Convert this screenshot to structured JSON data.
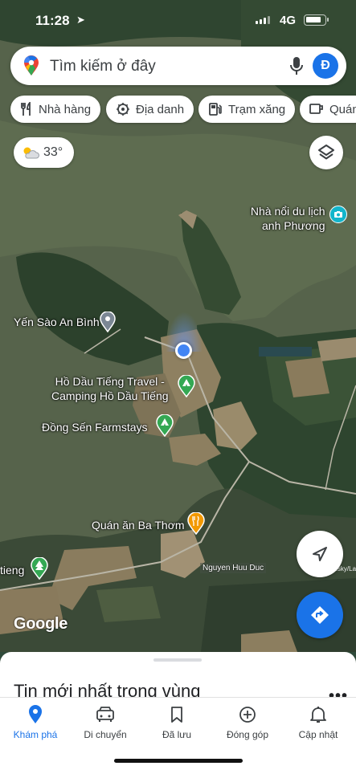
{
  "status_bar": {
    "time": "11:28",
    "network": "4G"
  },
  "search": {
    "placeholder": "Tìm kiếm ở đây",
    "avatar_letter": "Đ"
  },
  "chips": [
    {
      "label": "Nhà hàng",
      "icon": "fork-knife-icon"
    },
    {
      "label": "Địa danh",
      "icon": "landmark-icon"
    },
    {
      "label": "Trạm xăng",
      "icon": "gas-station-icon"
    },
    {
      "label": "Quán",
      "icon": "coffee-cup-icon"
    }
  ],
  "weather": {
    "temperature": "33°",
    "icon": "partly-sunny-icon"
  },
  "map": {
    "places": [
      {
        "name_line1": "Nhà nổi du lịch",
        "name_line2": "anh Phương",
        "icon": "camera-icon"
      },
      {
        "name": "Yến Sào An Bình",
        "icon": "pin-icon"
      },
      {
        "name_line1": "Hồ Dầu Tiếng Travel -",
        "name_line2": "Camping Hồ Dầu Tiếng",
        "icon": "tent-icon"
      },
      {
        "name": "Đồng Sến Farmstays",
        "icon": "tent-icon"
      },
      {
        "name": "Quán ăn Ba Thơm",
        "icon": "fork-knife-icon"
      },
      {
        "name": "tieng",
        "icon": "tree-icon"
      }
    ],
    "road_label": "Nguyen Huu Duc",
    "attribution": "©Bluesky/Landsat",
    "logo": "Google"
  },
  "sheet": {
    "title": "Tin mới nhất trong vùng",
    "more": "•••"
  },
  "nav": [
    {
      "label": "Khám phá",
      "icon": "location-pin-icon",
      "active": true
    },
    {
      "label": "Di chuyển",
      "icon": "car-icon",
      "active": false
    },
    {
      "label": "Đã lưu",
      "icon": "bookmark-icon",
      "active": false
    },
    {
      "label": "Đóng góp",
      "icon": "plus-circle-icon",
      "active": false
    },
    {
      "label": "Cập nhật",
      "icon": "bell-icon",
      "active": false
    }
  ],
  "colors": {
    "accent": "#1a73e8",
    "restaurant": "#f29900",
    "activity": "#34a853",
    "poi_gray": "#7b8794",
    "camera": "#12b5cb"
  }
}
